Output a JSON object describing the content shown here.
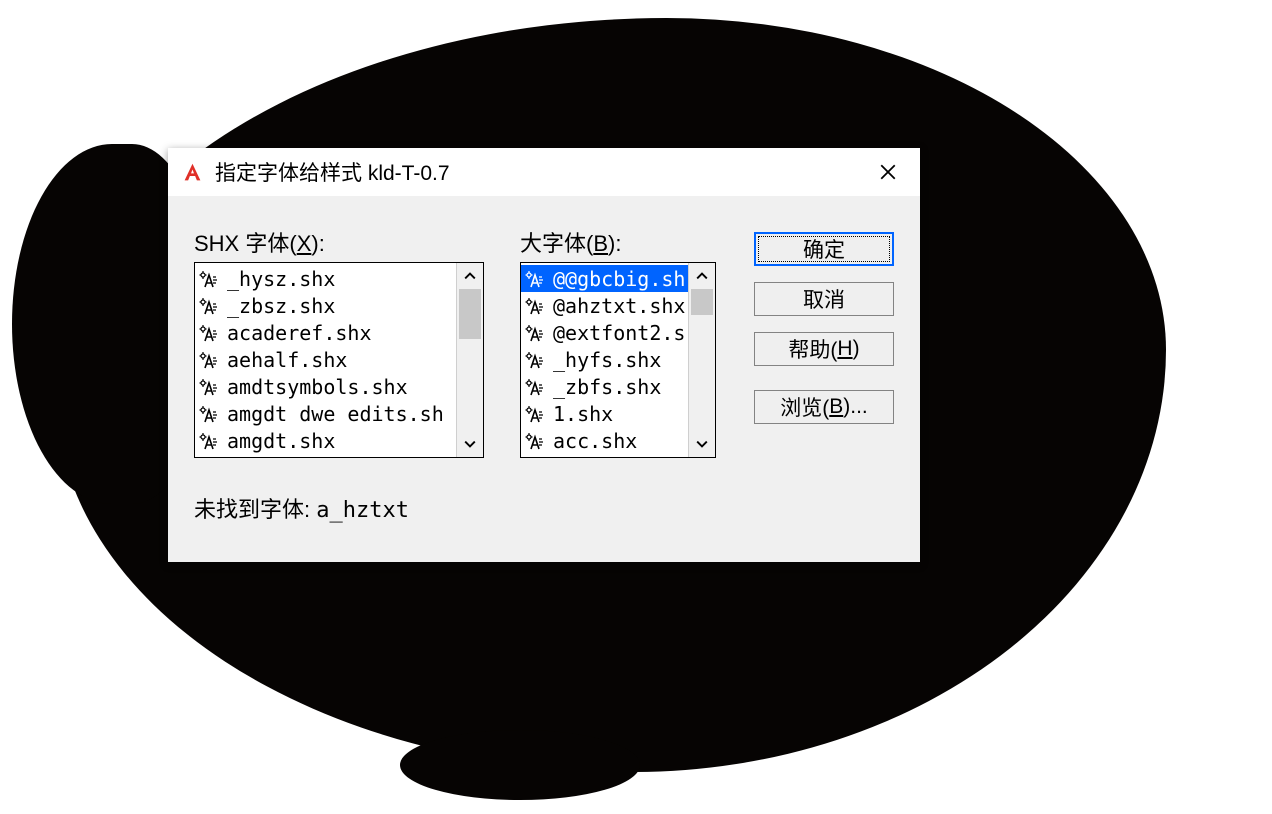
{
  "dialog": {
    "title": "指定字体给样式 kld-T-0.7",
    "shx_label_prefix": "SHX 字体(",
    "shx_accel": "X",
    "shx_label_suffix": "):",
    "big_label_prefix": "大字体(",
    "big_accel": "B",
    "big_label_suffix": "):",
    "notfound_label": "未找到字体: ",
    "notfound_value": "a_hztxt"
  },
  "shx_list": [
    "_hysz.shx",
    "_zbsz.shx",
    "acaderef.shx",
    "aehalf.shx",
    "amdtsymbols.shx",
    "amgdt dwe edits.sh",
    "amgdt.shx"
  ],
  "big_list": [
    "@@gbcbig.sh",
    "@ahztxt.shx",
    "@extfont2.s",
    "_hyfs.shx",
    "_zbfs.shx",
    "1.shx",
    "acc.shx"
  ],
  "big_selected_index": 0,
  "buttons": {
    "ok": "确定",
    "cancel": "取消",
    "help_prefix": "帮助(",
    "help_accel": "H",
    "help_suffix": ")",
    "browse_prefix": "浏览(",
    "browse_accel": "B",
    "browse_suffix": ")..."
  }
}
